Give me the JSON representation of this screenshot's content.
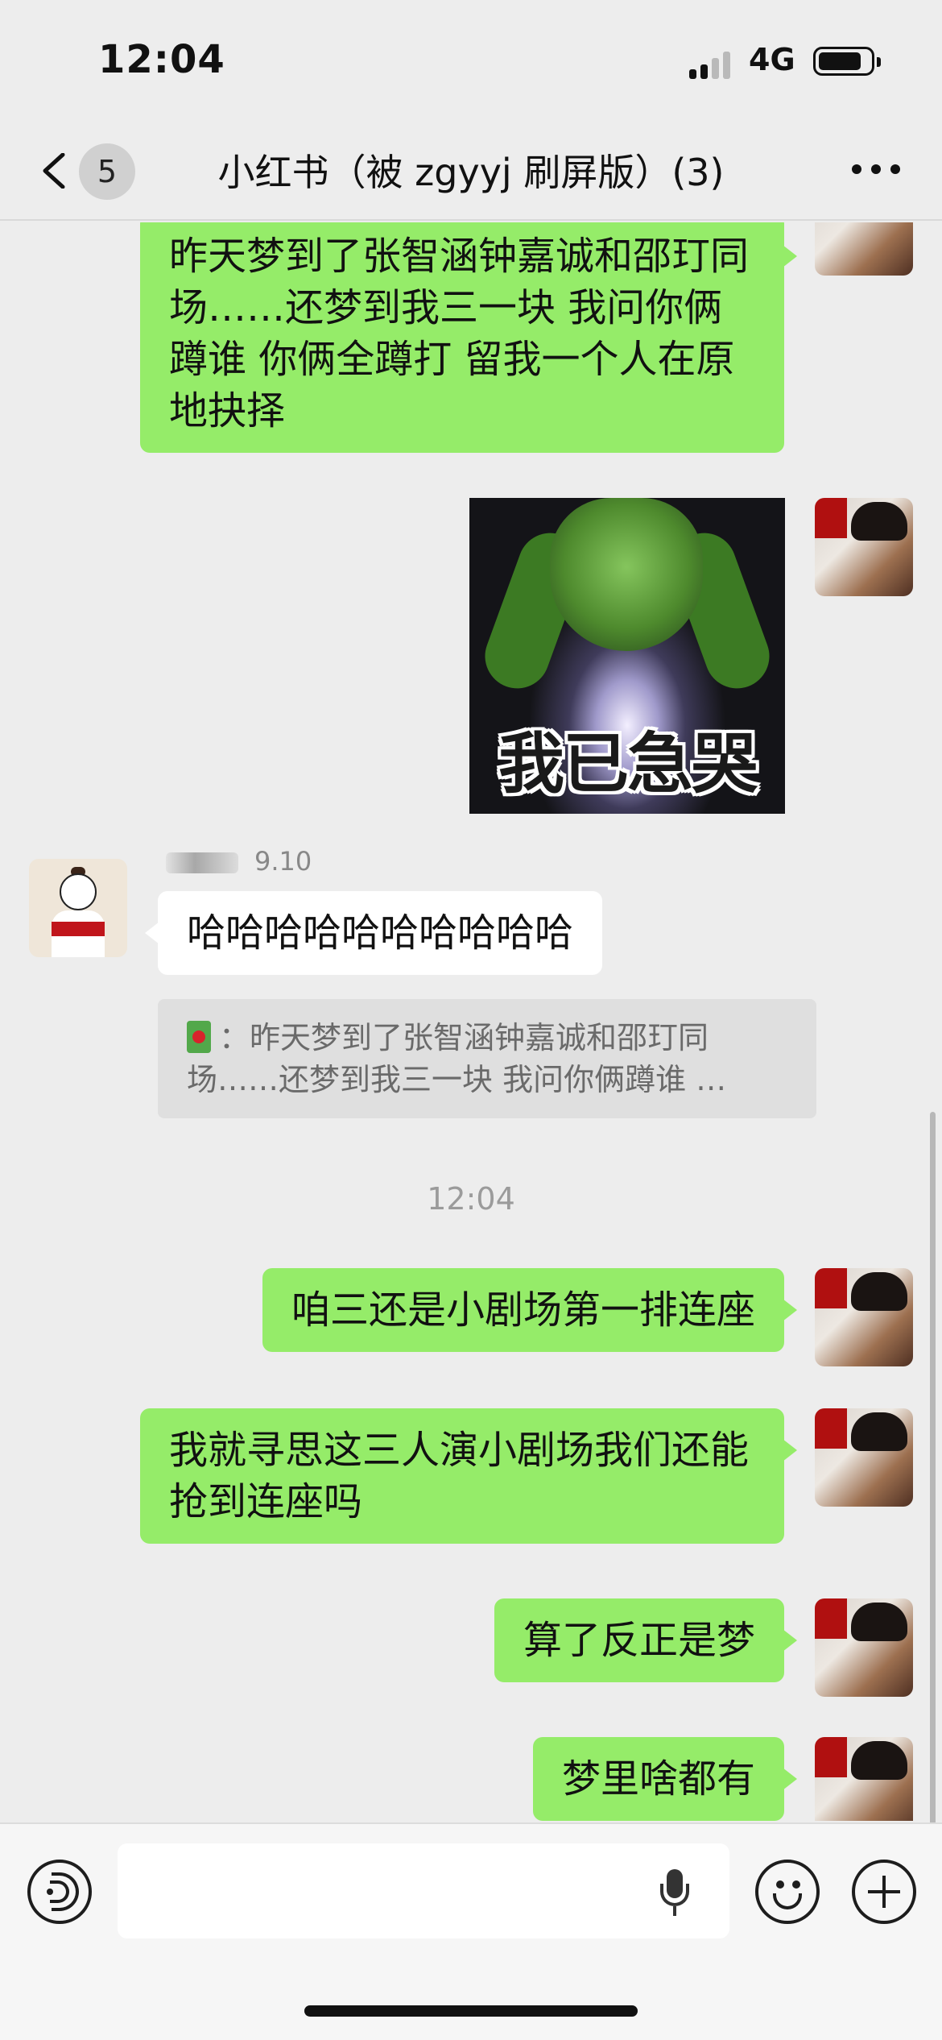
{
  "status_bar": {
    "time": "12:04",
    "network": "4G"
  },
  "header": {
    "unread_count": "5",
    "title": "小红书（被 zgyyj 刷屏版）(3)"
  },
  "messages": [
    {
      "from": "me",
      "type": "text",
      "text": "昨天梦到了张智涵钟嘉诚和邵玎同场……还梦到我三一块 我问你俩蹲谁 你俩全蹲打 留我一个人在原地抉择"
    },
    {
      "from": "me",
      "type": "sticker",
      "caption": "我已急哭"
    },
    {
      "from": "friend",
      "type": "text",
      "sender_suffix": "9.10",
      "text": "哈哈哈哈哈哈哈哈哈哈",
      "quote": "：昨天梦到了张智涵钟嘉诚和邵玎同场……还梦到我三一块 我问你俩蹲谁 …"
    },
    {
      "type": "time",
      "text": "12:04"
    },
    {
      "from": "me",
      "type": "text",
      "text": "咱三还是小剧场第一排连座"
    },
    {
      "from": "me",
      "type": "text",
      "text": "我就寻思这三人演小剧场我们还能抢到连座吗"
    },
    {
      "from": "me",
      "type": "text",
      "text": "算了反正是梦"
    },
    {
      "from": "me",
      "type": "text",
      "text": "梦里啥都有"
    }
  ],
  "input": {
    "value": "",
    "placeholder": ""
  },
  "icons": {
    "back": "chevron-left-icon",
    "more": "more-dots-icon",
    "voice": "voice-mode-icon",
    "mic": "microphone-icon",
    "emoji": "emoji-icon",
    "plus": "plus-icon"
  },
  "colors": {
    "background": "#ededed",
    "my_bubble": "#95ec69",
    "friend_bubble": "#ffffff",
    "quote_background": "#dfdfdf"
  }
}
